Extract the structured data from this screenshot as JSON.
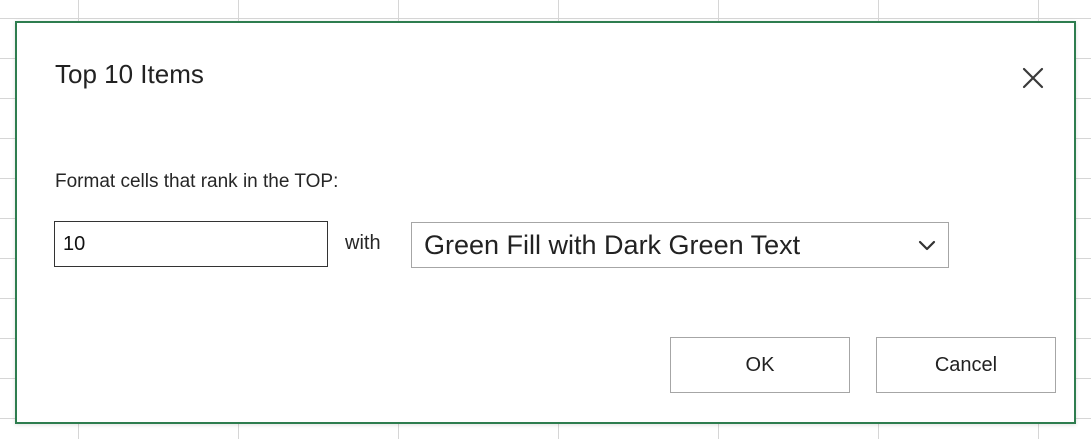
{
  "dialog": {
    "title": "Top 10 Items",
    "close_icon": "close-icon",
    "prompt": "Format cells that rank in the TOP:",
    "count_value": "10",
    "with_label": "with",
    "format_selected": "Green Fill with Dark Green Text",
    "dropdown_icon": "chevron-down-icon",
    "ok_label": "OK",
    "cancel_label": "Cancel"
  },
  "colors": {
    "dialog_border": "#2e7d4f",
    "gridlines": "#d6d6d6"
  }
}
